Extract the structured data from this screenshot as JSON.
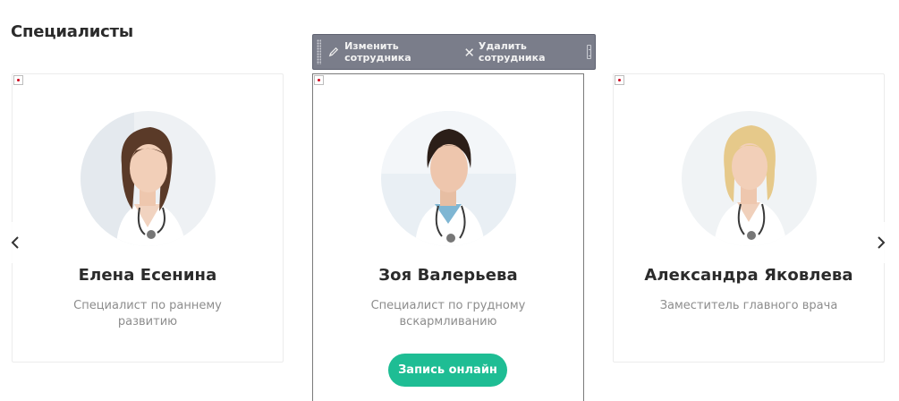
{
  "section": {
    "title": "Специалисты"
  },
  "admin_toolbar": {
    "edit_label": "Изменить сотрудника",
    "delete_label": "Удалить сотрудника"
  },
  "specialists": [
    {
      "name": "Елена Есенина",
      "position": "Специалист по раннему развитию"
    },
    {
      "name": "Зоя Валерьева",
      "position": "Специалист по грудному вскармливанию",
      "book_label": "Запись онлайн"
    },
    {
      "name": "Александра Яковлева",
      "position": "Заместитель главного врача"
    }
  ],
  "carousel": {
    "prev_icon": "chevron-left-icon",
    "next_icon": "chevron-right-icon"
  },
  "colors": {
    "accent": "#1ebd94",
    "toolbar": "#7a7d8a"
  }
}
